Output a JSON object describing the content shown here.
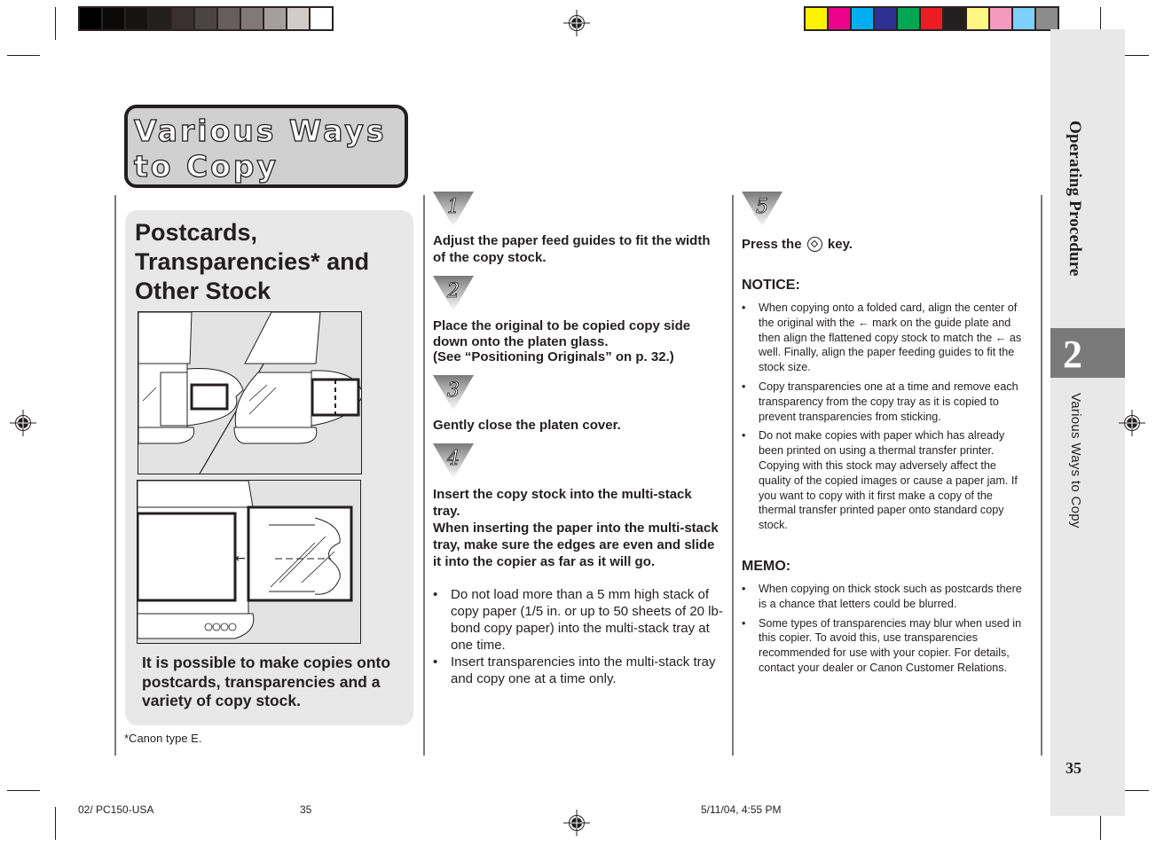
{
  "print_marks": {
    "gray_swatches": [
      "#000000",
      "#0b0a09",
      "#161413",
      "#231f1d",
      "#3a302e",
      "#4c4443",
      "#675d5c",
      "#847876",
      "#a69e9b",
      "#d3cbca",
      "#ffffff"
    ],
    "color_swatches": [
      "#fff200",
      "#ec008c",
      "#00aeef",
      "#2e3192",
      "#00a651",
      "#ed1c24",
      "#231f20",
      "#fff685",
      "#f49ac1",
      "#7dd0f7",
      "#8c8c8c"
    ]
  },
  "banner": {
    "line1": "Various Ways",
    "line2": "to Copy"
  },
  "side_tab": {
    "section_title": "Operating Procedure",
    "chapter_number": "2",
    "chapter_title": "Various Ways to Copy",
    "page_number": "35"
  },
  "left_panel": {
    "title_lines": [
      "Postcards,",
      "Transparencies* and",
      "Other Stock"
    ],
    "illustration_top": "copier-postcard-and-folded-card-illustration",
    "illustration_bottom": "copier-transparency-illustration",
    "description": "It is possible to make copies onto postcards, transparencies and a variety of copy stock.",
    "footnote": "*Canon type E."
  },
  "steps": [
    {
      "number": "1",
      "text": "Adjust the paper feed guides to fit the width of the copy stock."
    },
    {
      "number": "2",
      "text_lines": [
        "Place the original to be copied copy side down onto the platen glass.",
        "(See “Positioning Originals” on p. 32.)"
      ]
    },
    {
      "number": "3",
      "text": "Gently close the platen cover."
    },
    {
      "number": "4",
      "text_lines": [
        "Insert the copy stock into the multi-stack tray.",
        "When inserting the paper into the multi-stack tray, make sure the edges are even and slide it into the copier as far as it will go."
      ],
      "bullets": [
        "Do not load more than a 5 mm high stack of copy paper (1/5 in. or up to 50 sheets of 20 lb-bond copy paper) into the multi-stack tray at one time.",
        "Insert transparencies into the multi-stack tray and copy one at a time only."
      ]
    },
    {
      "number": "5",
      "text_before": "Press the",
      "key_icon": "start-key-icon",
      "text_after": "key."
    }
  ],
  "notice": {
    "heading": "NOTICE:",
    "bullets": [
      "When copying onto a folded card, align the center of the original with the ← mark on the guide plate and then align the flattened copy stock to match the ← as well. Finally, align the paper feeding guides to fit the stock size.",
      "Copy transparencies one at a time and remove each transparency from the copy tray as it is copied to prevent transparencies from sticking.",
      "Do not make copies with paper which has already been printed on using a thermal transfer printer. Copying with this stock may adversely affect the quality of the copied images or cause a paper jam. If you want to copy with it first make a copy of the thermal transfer printed paper onto standard copy stock."
    ]
  },
  "memo": {
    "heading": "MEMO:",
    "bullets": [
      "When copying on thick stock such as postcards there is a chance that letters could be blurred.",
      "Some types of transparencies may blur when used in this copier. To avoid this, use transparencies recommended for use with your copier. For details, contact your dealer or Canon Customer Relations."
    ]
  },
  "bullet_char": "•",
  "footer": {
    "file": "02/ PC150-USA",
    "page": "35",
    "timestamp": "5/11/04, 4:55 PM"
  }
}
